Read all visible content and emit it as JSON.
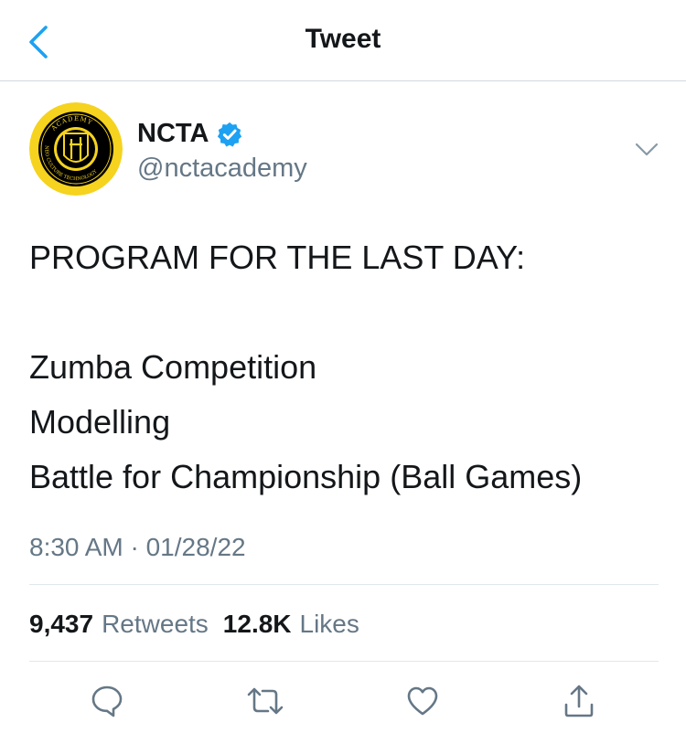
{
  "nav": {
    "title": "Tweet"
  },
  "author": {
    "display_name": "NCTA",
    "handle": "@nctacademy",
    "verified": true,
    "avatar": {
      "ring_color": "#f5d31f",
      "inner_color": "#000000",
      "top_arc_text": "ACADEMY",
      "side_arc_text": "NEO CULTURE TECHNOLOGY"
    }
  },
  "tweet": {
    "lines": [
      "PROGRAM FOR THE LAST DAY:",
      "",
      "Zumba Competition",
      "Modelling",
      "Battle for Championship (Ball Games)"
    ],
    "timestamp": "8:30 AM · 01/28/22"
  },
  "stats": {
    "retweets_count": "9,437",
    "retweets_label": "Retweets",
    "likes_count": "12.8K",
    "likes_label": "Likes"
  },
  "icons": {
    "back": "chevron-left-icon",
    "more": "chevron-down-icon",
    "reply": "reply-icon",
    "retweet": "retweet-icon",
    "like": "heart-icon",
    "share": "share-icon"
  },
  "colors": {
    "accent": "#1da1f2",
    "text_primary": "#14171a",
    "text_secondary": "#657786",
    "divider": "#e1e8ed"
  }
}
